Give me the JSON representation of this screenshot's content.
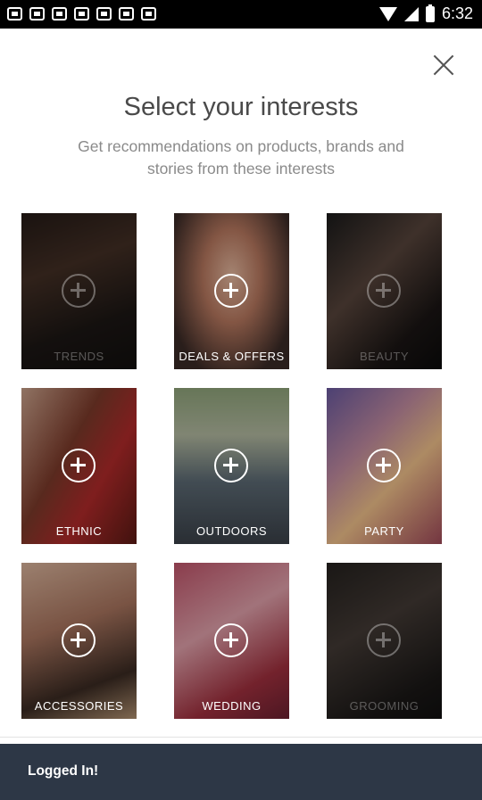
{
  "status_bar": {
    "time": "6:32",
    "icons": [
      "notification-icon",
      "notification-icon",
      "notification-icon",
      "notification-icon",
      "notification-icon",
      "notification-icon",
      "notification-icon",
      "wifi-icon",
      "signal-icon",
      "battery-icon"
    ]
  },
  "header": {
    "title": "Select your interests",
    "subtitle": "Get recommendations on products, brands and stories from these interests"
  },
  "interests": [
    {
      "label": "TRENDS",
      "selected": false,
      "muted": true
    },
    {
      "label": "DEALS & OFFERS",
      "selected": false,
      "muted": false
    },
    {
      "label": "BEAUTY",
      "selected": false,
      "muted": true
    },
    {
      "label": "ETHNIC",
      "selected": false,
      "muted": false
    },
    {
      "label": "OUTDOORS",
      "selected": false,
      "muted": false
    },
    {
      "label": "PARTY",
      "selected": false,
      "muted": false
    },
    {
      "label": "ACCESSORIES",
      "selected": false,
      "muted": false
    },
    {
      "label": "WEDDING",
      "selected": false,
      "muted": false
    },
    {
      "label": "GROOMING",
      "selected": false,
      "muted": true
    }
  ],
  "toast": {
    "message": "Logged In!"
  },
  "colors": {
    "toast_bg": "#2d3746",
    "title_text": "#4a4a4a",
    "subtitle_text": "#8a8a8a"
  }
}
